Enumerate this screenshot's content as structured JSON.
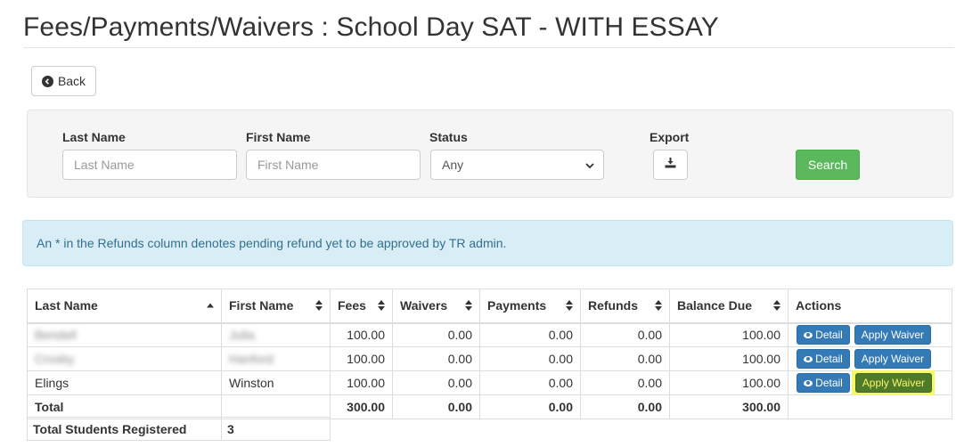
{
  "page": {
    "title": "Fees/Payments/Waivers : School Day SAT - WITH ESSAY"
  },
  "back": {
    "label": "Back",
    "icon": "arrow-circle-left-icon"
  },
  "filters": {
    "last_name": {
      "label": "Last Name",
      "placeholder": "Last Name"
    },
    "first_name": {
      "label": "First Name",
      "placeholder": "First Name"
    },
    "status": {
      "label": "Status",
      "selected": "Any"
    },
    "export": {
      "label": "Export",
      "icon": "download-icon"
    },
    "search_label": "Search"
  },
  "alert": {
    "text": "An * in the Refunds column denotes pending refund yet to be approved by TR admin."
  },
  "table": {
    "headers": {
      "last_name": "Last Name",
      "first_name": "First Name",
      "fees": "Fees",
      "waivers": "Waivers",
      "payments": "Payments",
      "refunds": "Refunds",
      "balance_due": "Balance Due",
      "actions": "Actions"
    },
    "rows": [
      {
        "last_name": "Bendell",
        "first_name": "Julia",
        "fees": "100.00",
        "waivers": "0.00",
        "payments": "0.00",
        "refunds": "0.00",
        "balance_due": "100.00",
        "redacted": true
      },
      {
        "last_name": "Crosby",
        "first_name": "Hanford",
        "fees": "100.00",
        "waivers": "0.00",
        "payments": "0.00",
        "refunds": "0.00",
        "balance_due": "100.00",
        "redacted": true
      },
      {
        "last_name": "Elings",
        "first_name": "Winston",
        "fees": "100.00",
        "waivers": "0.00",
        "payments": "0.00",
        "refunds": "0.00",
        "balance_due": "100.00",
        "redacted": false
      }
    ],
    "detail_label": "Detail",
    "apply_waiver_label": "Apply Waiver",
    "total": {
      "label": "Total",
      "fees": "300.00",
      "waivers": "0.00",
      "payments": "0.00",
      "refunds": "0.00",
      "balance_due": "300.00"
    }
  },
  "summary": {
    "label": "Total Students Registered",
    "value": "3"
  },
  "colors": {
    "primary": "#337ab7",
    "success": "#5cb85c",
    "info_bg": "#d9edf7",
    "info_text": "#31708f",
    "highlight": "#f7f76a"
  }
}
